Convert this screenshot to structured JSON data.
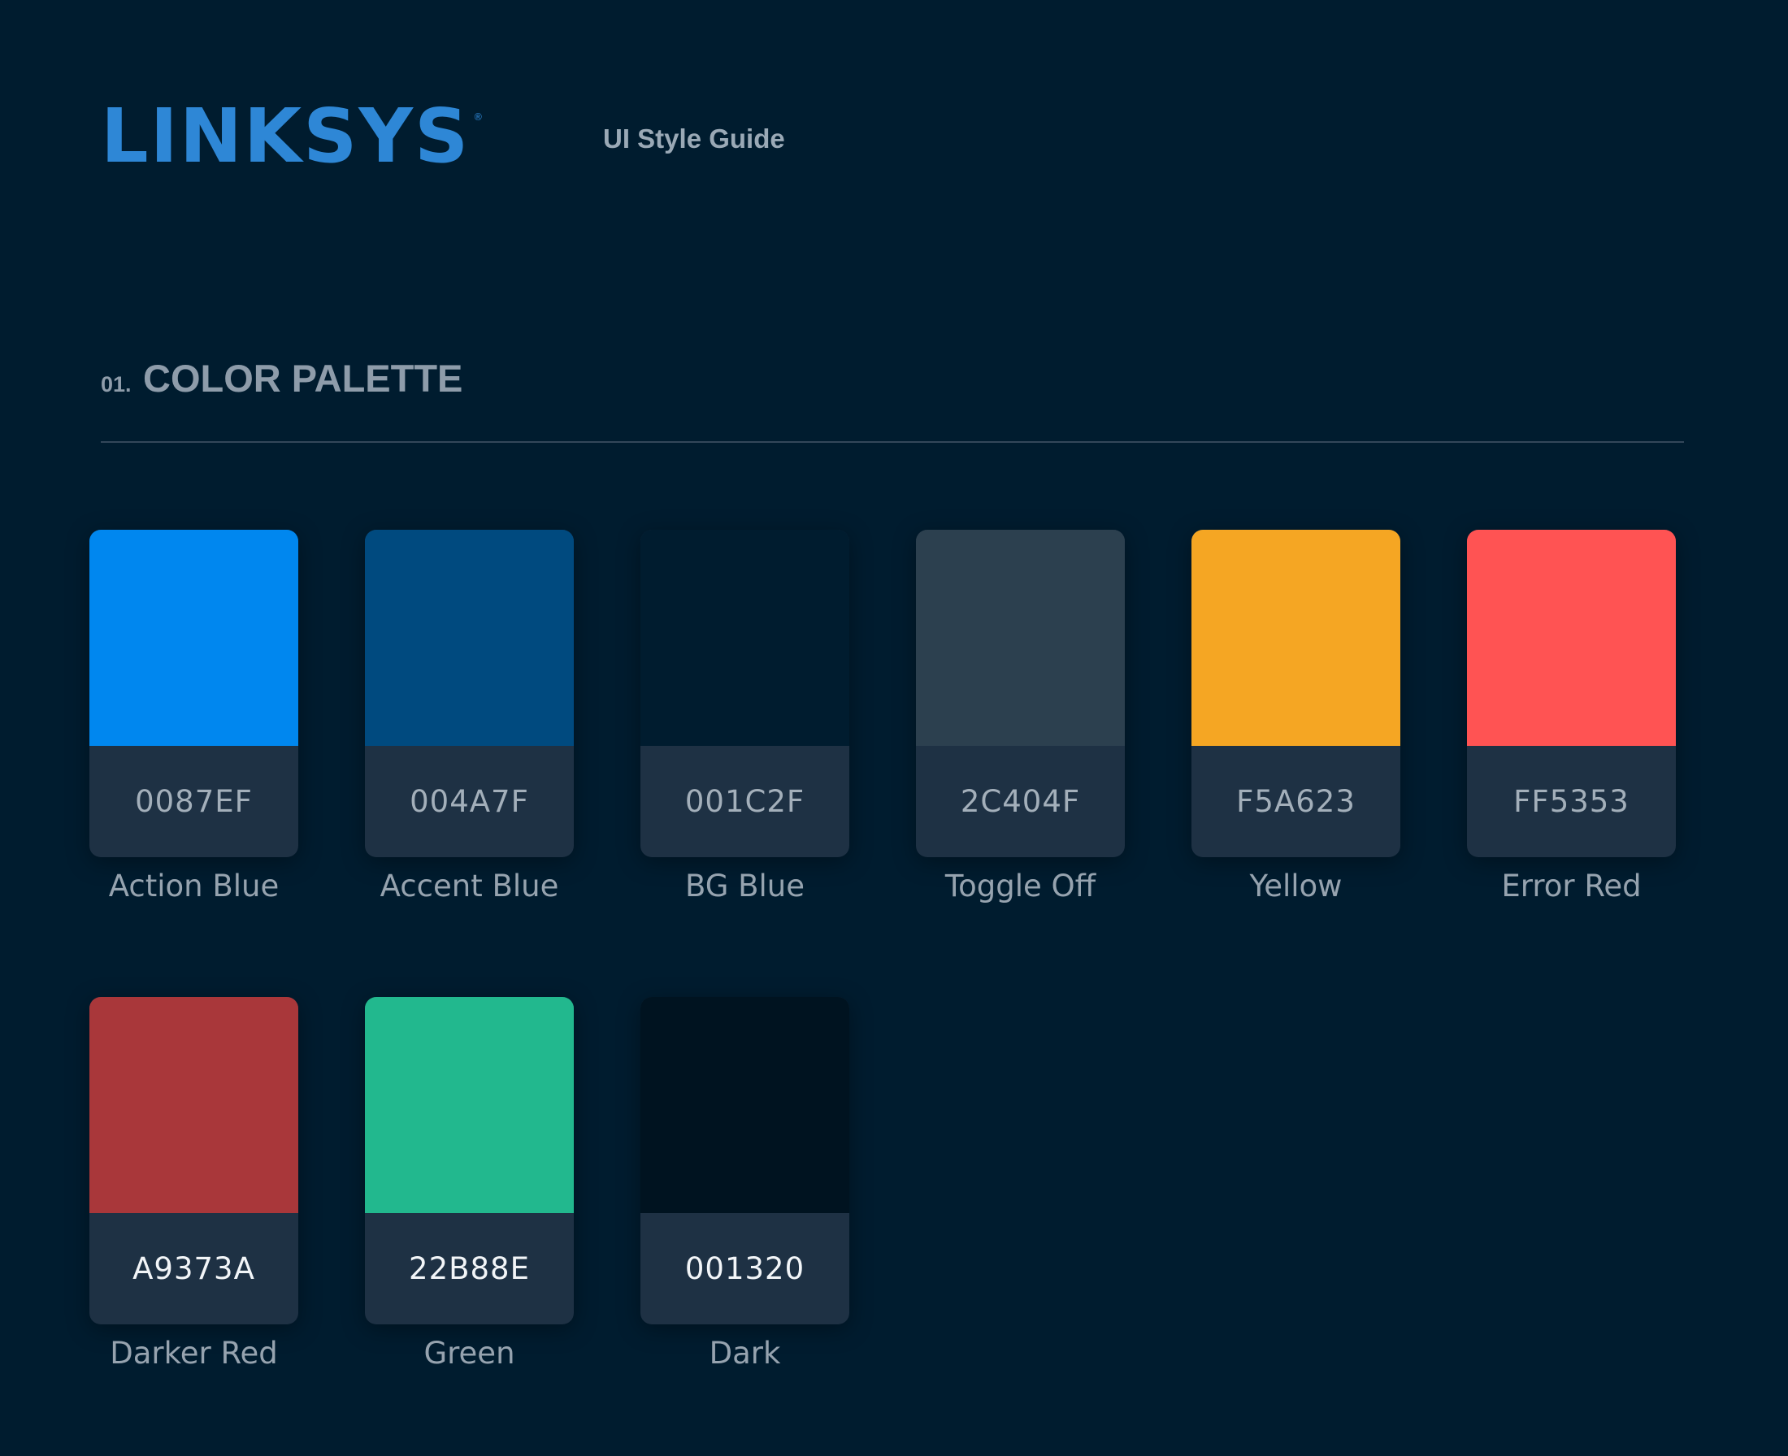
{
  "header": {
    "logo_text": "LINKSYS",
    "logo_mark": "®",
    "subtitle": "UI Style Guide"
  },
  "section": {
    "number": "01.",
    "title": "COLOR PALETTE"
  },
  "swatches": [
    {
      "hex": "0087EF",
      "name": "Action Blue",
      "color": "#0087EF"
    },
    {
      "hex": "004A7F",
      "name": "Accent Blue",
      "color": "#004A7F"
    },
    {
      "hex": "001C2F",
      "name": "BG Blue",
      "color": "#001C2F"
    },
    {
      "hex": "2C404F",
      "name": "Toggle Off",
      "color": "#2C404F"
    },
    {
      "hex": "F5A623",
      "name": "Yellow",
      "color": "#F5A623"
    },
    {
      "hex": "FF5353",
      "name": "Error Red",
      "color": "#FF5353"
    },
    {
      "hex": "A9373A",
      "name": "Darker Red",
      "color": "#A9373A",
      "bright_label": true
    },
    {
      "hex": "22B88E",
      "name": "Green",
      "color": "#22B88E",
      "bright_label": true
    },
    {
      "hex": "001320",
      "name": "Dark",
      "color": "#001320",
      "bright_label": true
    }
  ]
}
